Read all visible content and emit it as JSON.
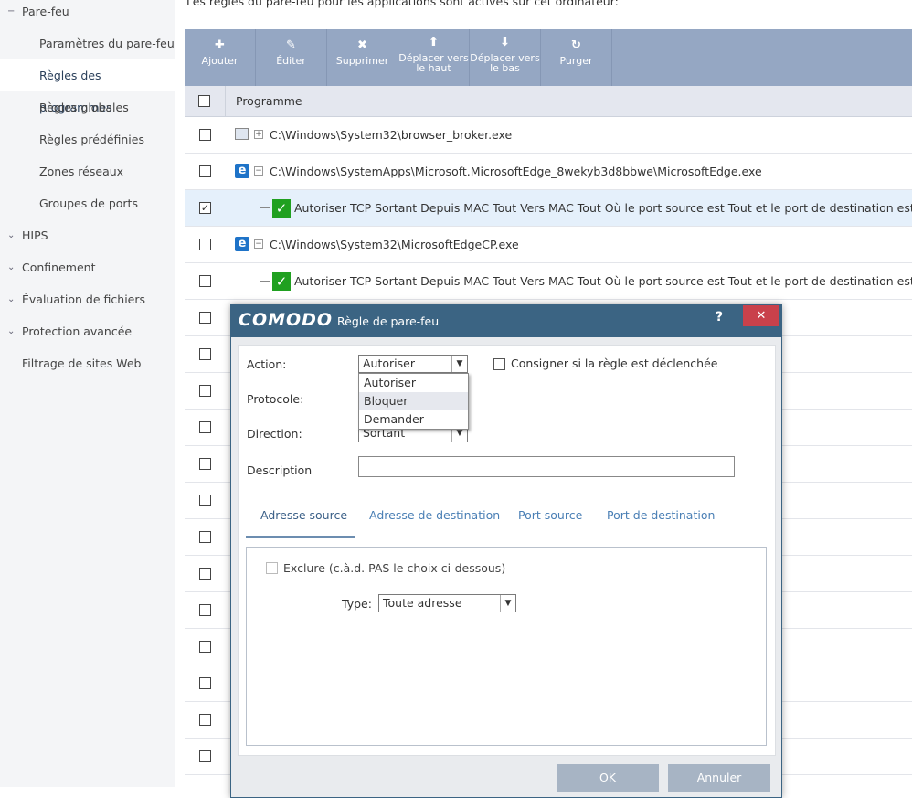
{
  "sidebar": {
    "items": [
      {
        "label": "Pare-feu",
        "chev": "−",
        "type": "top"
      },
      {
        "label": "Paramètres du pare-feu",
        "type": "sub"
      },
      {
        "label": "Règles des programmes",
        "type": "sub",
        "selected": true
      },
      {
        "label": "Règles globales",
        "type": "sub"
      },
      {
        "label": "Règles prédéfinies",
        "type": "sub"
      },
      {
        "label": "Zones réseaux",
        "type": "sub"
      },
      {
        "label": "Groupes de ports",
        "type": "sub"
      },
      {
        "label": "HIPS",
        "chev": "⌄",
        "type": "top"
      },
      {
        "label": "Confinement",
        "chev": "⌄",
        "type": "top"
      },
      {
        "label": "Évaluation de fichiers",
        "chev": "⌄",
        "type": "top"
      },
      {
        "label": "Protection avancée",
        "chev": "⌄",
        "type": "top"
      },
      {
        "label": "Filtrage de sites Web",
        "type": "top"
      }
    ]
  },
  "intro": "Les règles du pare-feu pour les applications sont actives sur cet ordinateur:",
  "toolbar": [
    {
      "icon": "✚",
      "label": "Ajouter",
      "name": "add"
    },
    {
      "icon": "✎",
      "label": "Éditer",
      "name": "edit"
    },
    {
      "icon": "✖",
      "label": "Supprimer",
      "name": "delete"
    },
    {
      "icon": "⬆",
      "label": "Déplacer vers le haut",
      "name": "move-up"
    },
    {
      "icon": "⬇",
      "label": "Déplacer vers le bas",
      "name": "move-down"
    },
    {
      "icon": "↻",
      "label": "Purger",
      "name": "purge"
    }
  ],
  "table": {
    "header": "Programme",
    "rows": [
      {
        "kind": "app",
        "icon": "exe",
        "text": "C:\\Windows\\System32\\browser_broker.exe",
        "expander": "+"
      },
      {
        "kind": "app",
        "icon": "edge",
        "text": "C:\\Windows\\SystemApps\\Microsoft.MicrosoftEdge_8wekyb3d8bbwe\\MicrosoftEdge.exe",
        "expander": "−"
      },
      {
        "kind": "rule",
        "text": "Autoriser TCP Sortant Depuis MAC Tout Vers MAC Tout Où le port source est Tout et le port de destination est Tout",
        "checked": true
      },
      {
        "kind": "app",
        "icon": "edge",
        "text": "C:\\Windows\\System32\\MicrosoftEdgeCP.exe",
        "expander": "−"
      },
      {
        "kind": "rule",
        "text": "Autoriser TCP Sortant Depuis MAC Tout Vers MAC Tout Où le port source est Tout et le port de destination est Tout"
      }
    ],
    "empty_rows": 13
  },
  "dialog": {
    "logo": "COMODO",
    "title": "Règle de pare-feu",
    "help": "?",
    "close": "✕",
    "action_label": "Action:",
    "action_value": "Autoriser",
    "action_options": [
      "Autoriser",
      "Bloquer",
      "Demander"
    ],
    "log_label": "Consigner si la règle est déclenchée",
    "protocol_label": "Protocole:",
    "direction_label": "Direction:",
    "direction_value": "Sortant",
    "description_label": "Description",
    "description_value": "",
    "tabs": [
      "Adresse source",
      "Adresse de destination",
      "Port source",
      "Port de destination"
    ],
    "exclude_label": "Exclure (c.à.d. PAS le choix ci-dessous)",
    "type_label": "Type:",
    "type_value": "Toute adresse",
    "ok": "OK",
    "cancel": "Annuler"
  }
}
